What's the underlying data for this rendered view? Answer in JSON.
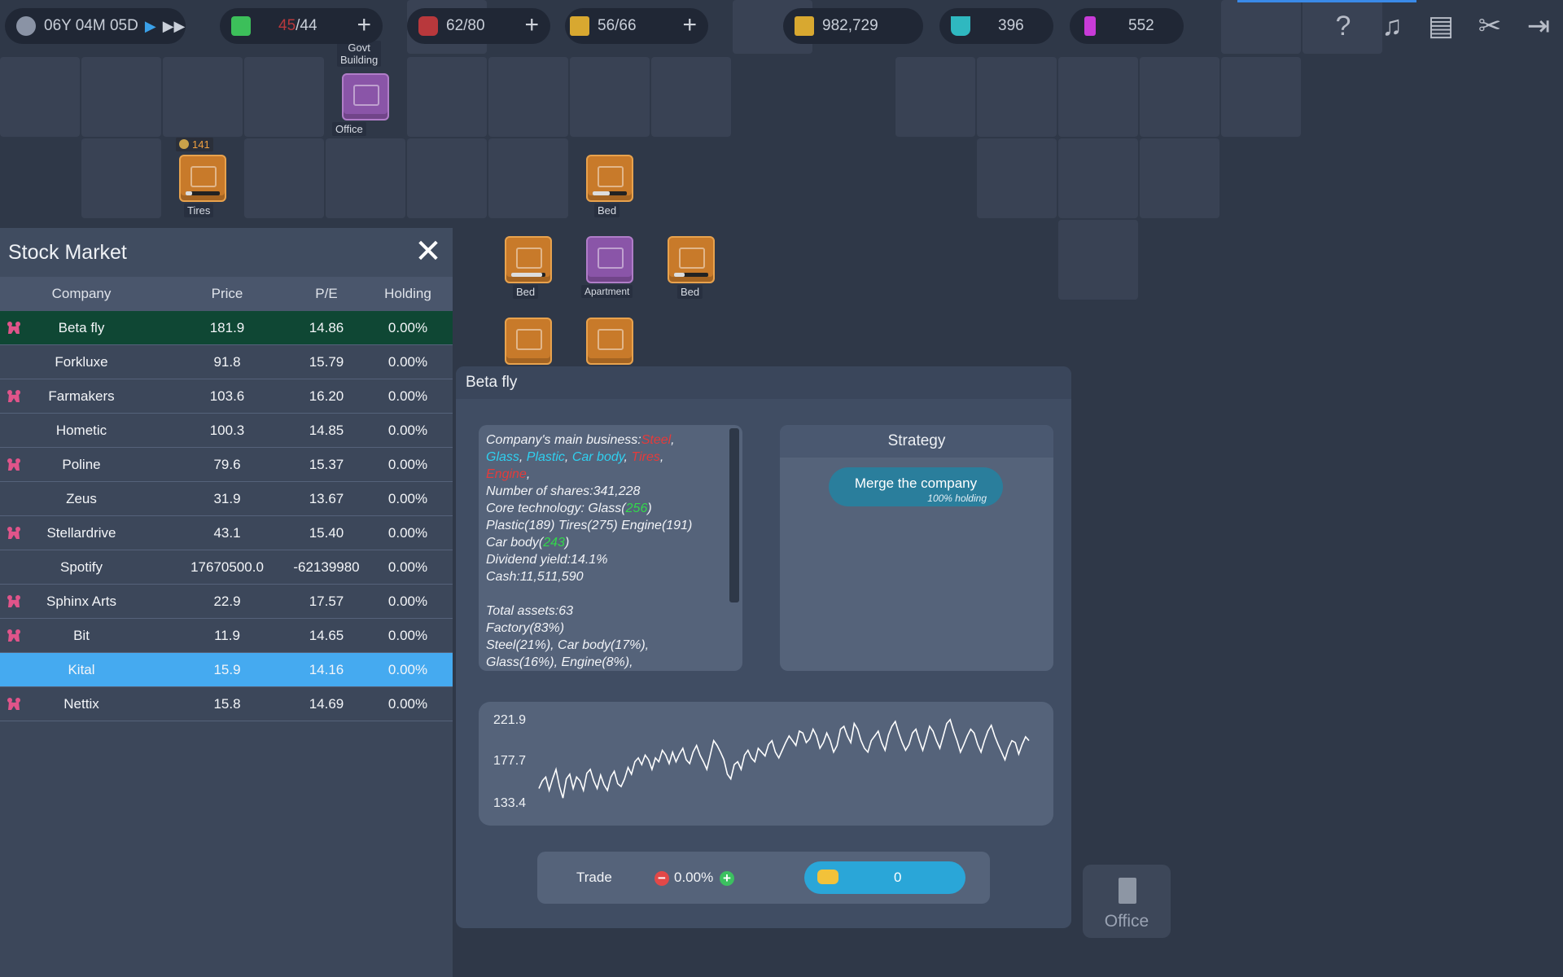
{
  "topbar": {
    "date": "06Y 04M 05D",
    "housing": {
      "current": "45",
      "max": "/44"
    },
    "workers": "62/80",
    "trucks": "56/66",
    "money": "982,729",
    "research": "396",
    "power": "552"
  },
  "map_labels": {
    "govt_building": "Govt\nBuilding",
    "office_top": "Office",
    "tires": "Tires",
    "tires_badge": "141",
    "bed1": "Bed",
    "bed2": "Bed",
    "apartment": "Apartment",
    "bed3": "Bed"
  },
  "stock_market": {
    "title": "Stock Market",
    "columns": [
      "Company",
      "Price",
      "P/E",
      "Holding"
    ],
    "rows": [
      {
        "name": "Beta fly",
        "price": "181.9",
        "pe": "14.86",
        "holding": "0.00%",
        "icon": "bear-icon"
      },
      {
        "name": "Forkluxe",
        "price": "91.8",
        "pe": "15.79",
        "holding": "0.00%",
        "icon": ""
      },
      {
        "name": "Farmakers",
        "price": "103.6",
        "pe": "16.20",
        "holding": "0.00%",
        "icon": "bear-icon"
      },
      {
        "name": "Hometic",
        "price": "100.3",
        "pe": "14.85",
        "holding": "0.00%",
        "icon": ""
      },
      {
        "name": "Poline",
        "price": "79.6",
        "pe": "15.37",
        "holding": "0.00%",
        "icon": "bear-icon"
      },
      {
        "name": "Zeus",
        "price": "31.9",
        "pe": "13.67",
        "holding": "0.00%",
        "icon": ""
      },
      {
        "name": "Stellardrive",
        "price": "43.1",
        "pe": "15.40",
        "holding": "0.00%",
        "icon": "bear-icon"
      },
      {
        "name": "Spotify",
        "price": "17670500.0",
        "pe": "-62139980",
        "holding": "0.00%",
        "icon": ""
      },
      {
        "name": "Sphinx Arts",
        "price": "22.9",
        "pe": "17.57",
        "holding": "0.00%",
        "icon": "bear-icon"
      },
      {
        "name": "Bit",
        "price": "11.9",
        "pe": "14.65",
        "holding": "0.00%",
        "icon": "bear-icon"
      },
      {
        "name": "Kital",
        "price": "15.9",
        "pe": "14.16",
        "holding": "0.00%",
        "icon": ""
      },
      {
        "name": "Nettix",
        "price": "15.8",
        "pe": "14.69",
        "holding": "0.00%",
        "icon": "bear-icon"
      }
    ]
  },
  "detail": {
    "title": "Beta fly",
    "info": {
      "main_business_label": "Company's main business:",
      "biz1": "Steel",
      "biz2": "Glass",
      "biz3": "Plastic",
      "biz4": "Car body",
      "biz5": "Tires",
      "biz6": "Engine",
      "shares": "Number of shares:341,228",
      "core_tech_label": "Core technology:  Glass(",
      "core_glass": "256",
      "line_tech2": "Plastic(189)  Tires(275)  Engine(191)",
      "car_body_label": "Car body(",
      "car_body_val": "243",
      "dividend": "Dividend yield:14.1%",
      "cash": "Cash:11,511,590",
      "assets": "Total assets:63",
      "factory": "Factory(83%)",
      "breakdown1": "  Steel(21%),  Car body(17%),",
      "breakdown2": "Glass(16%),  Engine(8%),"
    },
    "strategy": {
      "title": "Strategy",
      "merge_label": "Merge the company",
      "merge_sub": "100% holding"
    },
    "trade": {
      "label": "Trade",
      "percent": "0.00%",
      "quantity": "0"
    }
  },
  "chart_data": {
    "type": "line",
    "y_ticks": [
      "221.9",
      "177.7",
      "133.4"
    ],
    "ylim": [
      133.4,
      221.9
    ],
    "series": [
      {
        "values": [
          150,
          158,
          162,
          148,
          160,
          170,
          152,
          140,
          160,
          165,
          150,
          162,
          158,
          148,
          166,
          170,
          158,
          150,
          164,
          154,
          148,
          162,
          168,
          155,
          152,
          160,
          172,
          165,
          178,
          182,
          175,
          185,
          180,
          170,
          182,
          178,
          190,
          185,
          176,
          188,
          178,
          186,
          192,
          180,
          176,
          188,
          195,
          185,
          178,
          170,
          185,
          200,
          195,
          188,
          180,
          165,
          160,
          175,
          178,
          170,
          185,
          190,
          182,
          178,
          192,
          188,
          184,
          196,
          200,
          188,
          182,
          190,
          198,
          205,
          200,
          195,
          210,
          208,
          198,
          202,
          212,
          205,
          192,
          198,
          208,
          200,
          188,
          195,
          212,
          215,
          205,
          198,
          218,
          212,
          200,
          192,
          188,
          200,
          205,
          210,
          198,
          190,
          206,
          215,
          220,
          208,
          198,
          190,
          196,
          208,
          212,
          200,
          190,
          202,
          215,
          210,
          200,
          192,
          205,
          218,
          222,
          210,
          200,
          188,
          196,
          205,
          212,
          208,
          196,
          188,
          200,
          210,
          216,
          205,
          196,
          188,
          180,
          192,
          200,
          198,
          186,
          196,
          204,
          200
        ]
      }
    ]
  },
  "office_button": {
    "label": "Office"
  },
  "colors": {
    "bear": "#e0548a",
    "accent_blue": "#45aaf0",
    "selected_green": "#0f4734"
  }
}
